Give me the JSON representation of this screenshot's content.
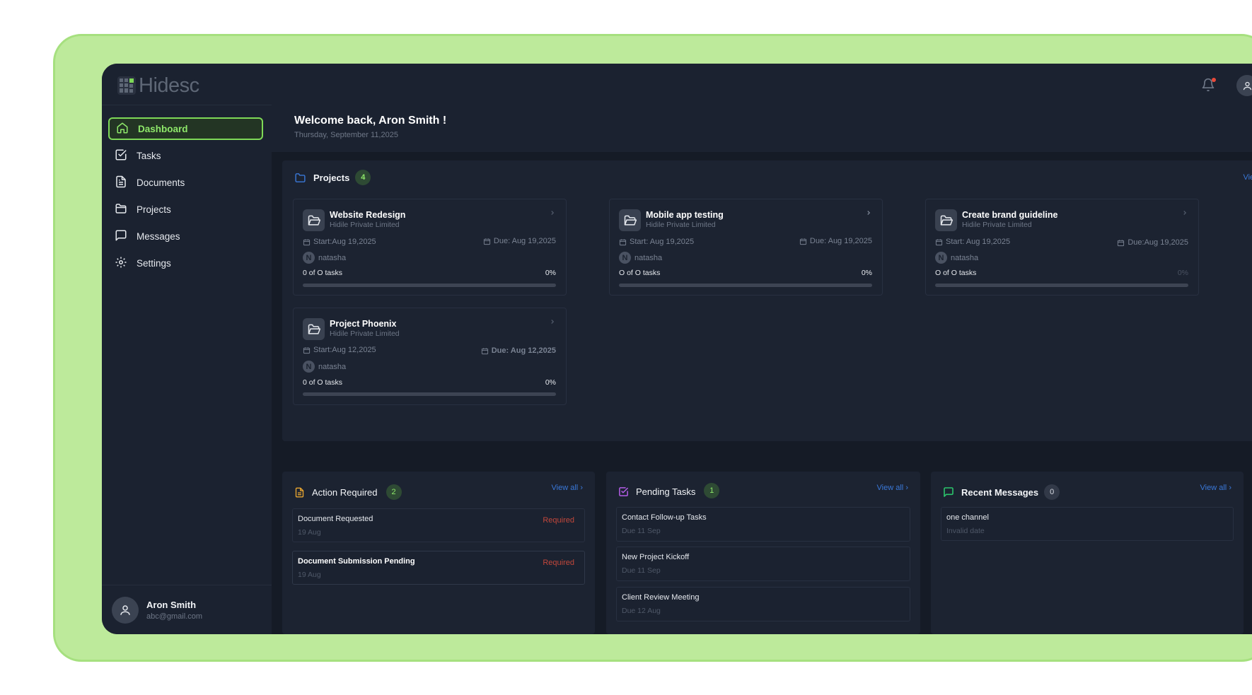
{
  "app": {
    "logo_text": "Hidesc"
  },
  "sidebar": {
    "items": [
      {
        "label": "Dashboard",
        "icon": "home-icon",
        "active": true
      },
      {
        "label": "Tasks",
        "icon": "check-square-icon"
      },
      {
        "label": "Documents",
        "icon": "document-icon"
      },
      {
        "label": "Projects",
        "icon": "folder-icon"
      },
      {
        "label": "Messages",
        "icon": "message-icon"
      },
      {
        "label": "Settings",
        "icon": "gear-icon"
      }
    ],
    "user": {
      "name": "Aron Smith",
      "email": "abc@gmail.com"
    }
  },
  "header": {
    "welcome": "Welcome back, Aron Smith !",
    "date": "Thursday, September 11,2025"
  },
  "projects": {
    "title": "Projects",
    "count": "4",
    "view_all": "View all",
    "cards": [
      {
        "title": "Website Redesign",
        "company": "Hidile Private Limited",
        "start": "Start:Aug 19,2025",
        "due": "Due: Aug 19,2025",
        "assignee_initial": "N",
        "assignee": "natasha",
        "tasks": "0 of O tasks",
        "percent": "0%",
        "progress": 0
      },
      {
        "title": "Mobile app testing",
        "company": "Hidile Private Limited",
        "start": "Start: Aug 19,2025",
        "due": "Due: Aug 19,2025",
        "assignee_initial": "N",
        "assignee": "natasha",
        "tasks": "O of O tasks",
        "percent": "0%",
        "progress": 0
      },
      {
        "title": "Create brand guideline",
        "company": "Hidile Private Limited",
        "start": "Start: Aug 19,2025",
        "due": "Due:Aug 19,2025",
        "assignee_initial": "N",
        "assignee": "natasha",
        "tasks": "O of O tasks",
        "percent": "0%",
        "progress": 0
      },
      {
        "title": "Project Phoenix",
        "company": "Hidile Private Limited",
        "start": "Start:Aug 12,2025",
        "due": "Due: Aug 12,2025",
        "assignee_initial": "N",
        "assignee": "natasha",
        "tasks": "0 of O tasks",
        "percent": "0%",
        "progress": 0
      }
    ]
  },
  "action_required": {
    "title": "Action Required",
    "count": "2",
    "view_all": "View all",
    "items": [
      {
        "title": "Document Requested",
        "date": "19 Aug",
        "status": "Required"
      },
      {
        "title": "Document Submission Pending",
        "date": "19 Aug",
        "status": "Required"
      }
    ]
  },
  "pending_tasks": {
    "title": "Pending Tasks",
    "count": "1",
    "view_all": "View all",
    "items": [
      {
        "title": "Contact Follow-up Tasks",
        "date": "Due 11 Sep"
      },
      {
        "title": "New Project Kickoff",
        "date": "Due 11 Sep"
      },
      {
        "title": "Client Review Meeting",
        "date": "Due 12 Aug"
      }
    ]
  },
  "recent_messages": {
    "title": "Recent Messages",
    "count": "0",
    "view_all": "View all",
    "items": [
      {
        "title": "one channel",
        "date": "Invalid date"
      }
    ]
  },
  "colors": {
    "accent": "#7ed957",
    "link": "#3a78d8",
    "danger": "#c2473b",
    "background": "#1b2230",
    "frame": "#bdea9b"
  }
}
